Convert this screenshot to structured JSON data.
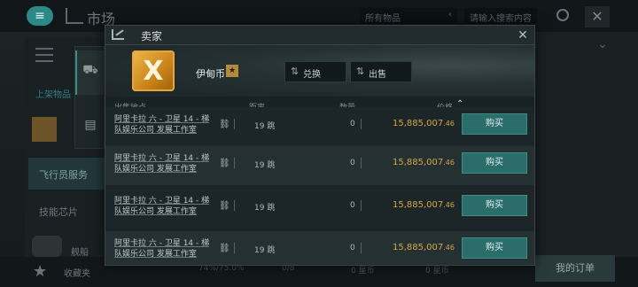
{
  "background": {
    "market_title": "市场",
    "filter_label": "所有物品",
    "search_placeholder": "请输入搜索内容",
    "top_items_label": "上架物品",
    "pilot_services_label": "飞行员服务",
    "skill_chips_label": "技能芯片",
    "ship_label": "舰船",
    "favorites_label": "收藏夹",
    "my_orders_label": "我的订单",
    "bottom_stat_1": "74%/75.0%",
    "bottom_stat_2": "0/8",
    "bottom_stat_3": "0 星币",
    "bottom_stat_4": "0 星币"
  },
  "modal": {
    "title": "卖家",
    "item_name": "伊甸币",
    "item_glyph": "X",
    "buttons": {
      "exchange": "兑换",
      "sell": "出售"
    },
    "columns": {
      "location": "出售地点",
      "distance": "距离",
      "quantity": "数量",
      "price": "价格"
    },
    "rows": [
      {
        "location": "阿里卡拉 六 - 卫星 14 - 梯队娱乐公司 发展工作室",
        "distance": "19 跳",
        "quantity": "0",
        "price_main": "15,885,007",
        "price_frac": ".46",
        "buy": "购买"
      },
      {
        "location": "阿里卡拉 六 - 卫星 14 - 梯队娱乐公司 发展工作室",
        "distance": "19 跳",
        "quantity": "0",
        "price_main": "15,885,007",
        "price_frac": ".46",
        "buy": "购买"
      },
      {
        "location": "阿里卡拉 六 - 卫星 14 - 梯队娱乐公司 发展工作室",
        "distance": "19 跳",
        "quantity": "0",
        "price_main": "15,885,007",
        "price_frac": ".46",
        "buy": "购买"
      },
      {
        "location": "阿里卡拉 六 - 卫星 14 - 梯队娱乐公司 发展工作室",
        "distance": "19 跳",
        "quantity": "0",
        "price_main": "15,885,007",
        "price_frac": ".46",
        "buy": "购买"
      }
    ]
  },
  "colors": {
    "accent": "#2b6d6a",
    "price": "#d4a54a",
    "item_gold": "#e9a636"
  }
}
